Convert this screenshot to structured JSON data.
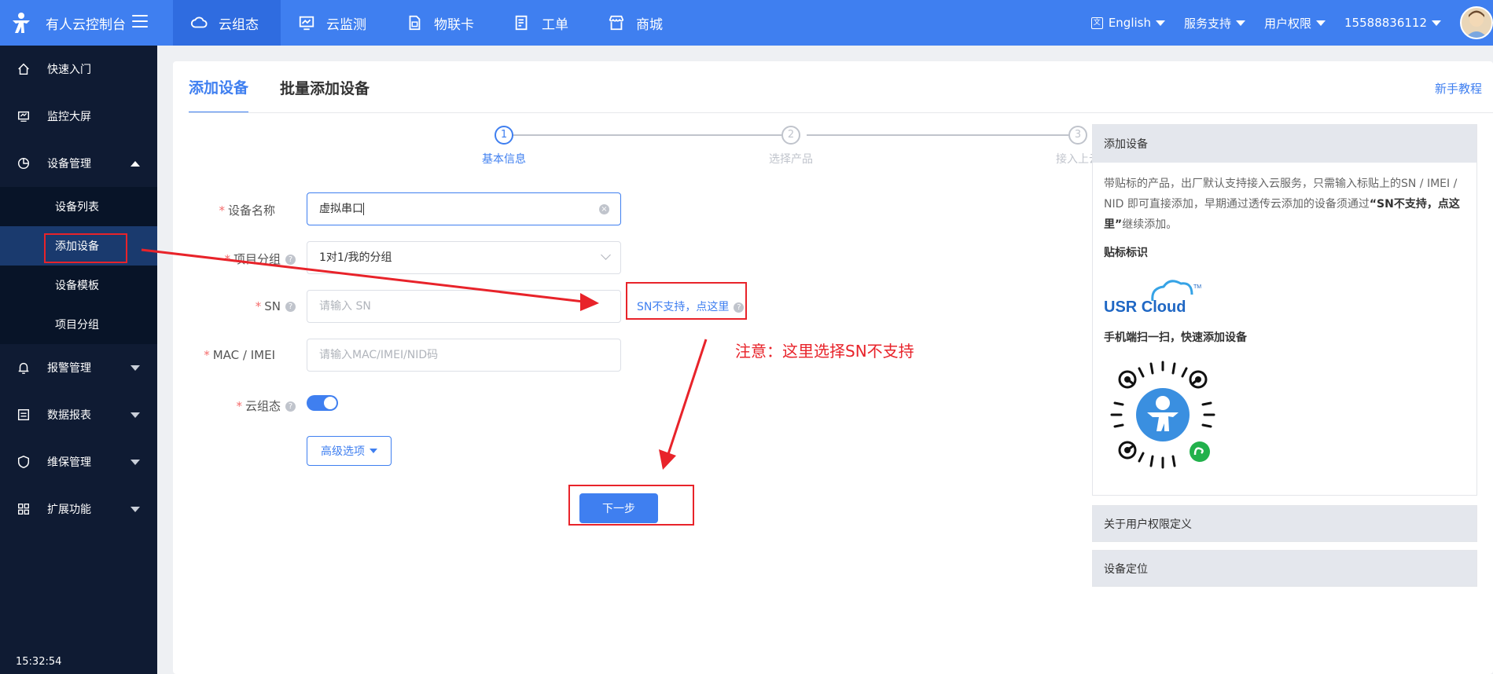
{
  "topbar": {
    "brand": "有人云控制台",
    "nav": [
      {
        "label": "云组态",
        "icon": "cloud-icon",
        "active": true
      },
      {
        "label": "云监测",
        "icon": "monitor-chart-icon",
        "active": false
      },
      {
        "label": "物联卡",
        "icon": "sim-card-icon",
        "active": false
      },
      {
        "label": "工单",
        "icon": "ticket-icon",
        "active": false
      },
      {
        "label": "商城",
        "icon": "shop-icon",
        "active": false
      }
    ],
    "language": "English",
    "support": "服务支持",
    "permissions": "用户权限",
    "account": "15588836112"
  },
  "sidebar": {
    "items": [
      {
        "label": "快速入门",
        "icon": "home-icon"
      },
      {
        "label": "监控大屏",
        "icon": "screen-icon"
      },
      {
        "label": "设备管理",
        "icon": "device-icon"
      },
      {
        "label": "报警管理",
        "icon": "alarm-icon"
      },
      {
        "label": "数据报表",
        "icon": "report-icon"
      },
      {
        "label": "维保管理",
        "icon": "shield-icon"
      },
      {
        "label": "扩展功能",
        "icon": "apps-icon"
      }
    ],
    "device_sub": [
      "设备列表",
      "添加设备",
      "设备模板",
      "项目分组"
    ],
    "time": "15:32:54"
  },
  "main": {
    "tabs": [
      "添加设备",
      "批量添加设备"
    ],
    "tutorial": "新手教程",
    "steps": [
      {
        "num": "1",
        "label": "基本信息"
      },
      {
        "num": "2",
        "label": "选择产品"
      },
      {
        "num": "3",
        "label": "接入上云"
      }
    ],
    "form": {
      "name_label": "设备名称",
      "name_value": "虚拟串口",
      "group_label": "项目分组",
      "group_value": "1对1/我的分组",
      "sn_label": "SN",
      "sn_placeholder": "请输入 SN",
      "sn_unsupported": "SN不支持，点这里",
      "mac_label": "MAC / IMEI",
      "mac_placeholder": "请输入MAC/IMEI/NID码",
      "cloud_label": "云组态",
      "cloud_enabled": true,
      "advanced": "高级选项",
      "next": "下一步"
    },
    "annotation": "注意：这里选择SN不支持"
  },
  "help_panel": {
    "title": "添加设备",
    "desc_1": "带贴标的产品，出厂默认支持接入云服务，只需输入标贴上的SN / IMEI /",
    "desc_2_pre": "NID 即可直接添加，早期通过透传云添加的设备须通过",
    "desc_2_bold": "“SN不支持，点这",
    "desc_3_bold": "里”",
    "desc_3_post": "继续添加。",
    "label_title": "贴标标识",
    "logo_text": "USR Cloud",
    "logo_tm": "TM",
    "scan_title": "手机端扫一扫，快速添加设备",
    "section2": "关于用户权限定义",
    "section3": "设备定位"
  },
  "colors": {
    "primary": "#3f7ff0",
    "sidebar": "#0f1b33",
    "annotation": "#e8232a"
  }
}
